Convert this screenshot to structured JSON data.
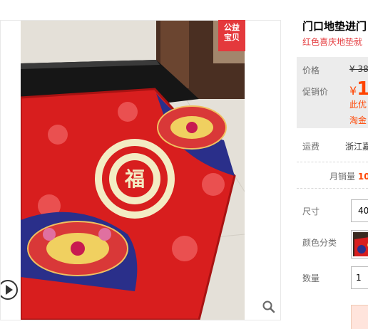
{
  "product": {
    "title": "门口地垫进门",
    "subtitle": "红色喜庆地垫就"
  },
  "image": {
    "badge_line1": "公益",
    "badge_line2": "宝贝"
  },
  "price": {
    "label": "价格",
    "original": "¥ 38",
    "promo_label": "促销价",
    "promo_currency": "¥",
    "promo_value": "1",
    "promo_note": "此优",
    "coupon_link": "淘金"
  },
  "shipping": {
    "label": "运费",
    "value": "浙江嘉"
  },
  "sales": {
    "label": "月销量",
    "value": "10"
  },
  "options": {
    "size_label": "尺寸",
    "size_value": "40",
    "color_label": "颜色分类",
    "quantity_label": "数量",
    "quantity_value": "1"
  },
  "colors": {
    "accent": "#f40",
    "badge": "#e4393c",
    "mat_red": "#d81e1e"
  }
}
